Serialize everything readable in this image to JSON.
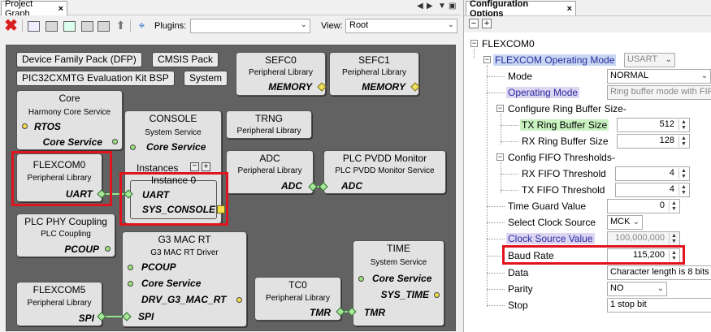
{
  "left_panel": {
    "tab_title": "Project Graph",
    "toolbar": {
      "plugins_label": "Plugins:",
      "plugins_value": "",
      "view_label": "View:",
      "view_value": "Root"
    },
    "chips": {
      "dfp": "Device Family Pack (DFP)",
      "cmsis": "CMSIS Pack",
      "bsp": "PIC32CXMTG Evaluation Kit BSP",
      "system": "System"
    },
    "nodes": {
      "sefc0": {
        "title": "SEFC0",
        "sub": "Peripheral Library",
        "cap": "MEMORY"
      },
      "sefc1": {
        "title": "SEFC1",
        "sub": "Peripheral Library",
        "cap": "MEMORY"
      },
      "core": {
        "title": "Core",
        "sub": "Harmony Core Service",
        "dep": "RTOS",
        "cap": "Core Service"
      },
      "console": {
        "title": "CONSOLE",
        "sub": "System Service",
        "cap": "Core Service",
        "instances_label": "Instances",
        "instance_title": "Instance 0",
        "dep1": "UART",
        "dep2": "SYS_CONSOLE"
      },
      "trng": {
        "title": "TRNG",
        "sub": "Peripheral Library"
      },
      "flexcom0": {
        "title": "FLEXCOM0",
        "sub": "Peripheral Library",
        "cap": "UART"
      },
      "adc": {
        "title": "ADC",
        "sub": "Peripheral Library",
        "cap": "ADC"
      },
      "plc_pvdd": {
        "title": "PLC PVDD Monitor",
        "sub": "PLC PVDD Monitor Service",
        "dep": "ADC"
      },
      "plc_phy": {
        "title": "PLC PHY Coupling",
        "sub": "PLC Coupling",
        "cap": "PCOUP"
      },
      "g3mac": {
        "title": "G3 MAC RT",
        "sub": "G3 MAC RT Driver",
        "dep1": "PCOUP",
        "dep2": "Core Service",
        "cap": "DRV_G3_MAC_RT",
        "dep3": "SPI"
      },
      "time": {
        "title": "TIME",
        "sub": "System Service",
        "dep1": "Core Service",
        "cap": "SYS_TIME",
        "dep2": "TMR"
      },
      "tc0": {
        "title": "TC0",
        "sub": "Peripheral Library",
        "cap": "TMR"
      },
      "flexcom5": {
        "title": "FLEXCOM5",
        "sub": "Peripheral Library",
        "cap": "SPI"
      }
    }
  },
  "right_panel": {
    "tab_title": "Configuration Options",
    "tree": {
      "root": "FLEXCOM0",
      "operating_mode_label": "FLEXCOM Operating Mode",
      "operating_mode_value": "USART",
      "mode_label": "Mode",
      "mode_value": "NORMAL",
      "op_mode_label": "Operating Mode",
      "op_mode_value": "Ring buffer mode with FIFO",
      "ring_label": "Configure Ring Buffer Size-",
      "tx_ring_label": "TX Ring Buffer Size",
      "tx_ring_value": "512",
      "rx_ring_label": "RX Ring Buffer Size",
      "rx_ring_value": "128",
      "fifo_label": "Config FIFO Thresholds-",
      "rx_fifo_label": "RX FIFO Threshold",
      "rx_fifo_value": "4",
      "tx_fifo_label": "TX FIFO Threshold",
      "tx_fifo_value": "4",
      "guard_label": "Time Guard Value",
      "guard_value": "0",
      "clk_src_label": "Select Clock Source",
      "clk_src_value": "MCK",
      "clk_val_label": "Clock Source Value",
      "clk_val_value": "100,000,000",
      "baud_label": "Baud Rate",
      "baud_value": "115,200",
      "data_label": "Data",
      "data_value": "Character length is 8 bits",
      "parity_label": "Parity",
      "parity_value": "NO",
      "stop_label": "Stop",
      "stop_value": "1 stop bit"
    }
  },
  "colors": {
    "canvas": "#626262",
    "highlight_red": "#e0141e",
    "node_fill": "#e2e2e2",
    "green_diamond": "#a8e89a"
  }
}
